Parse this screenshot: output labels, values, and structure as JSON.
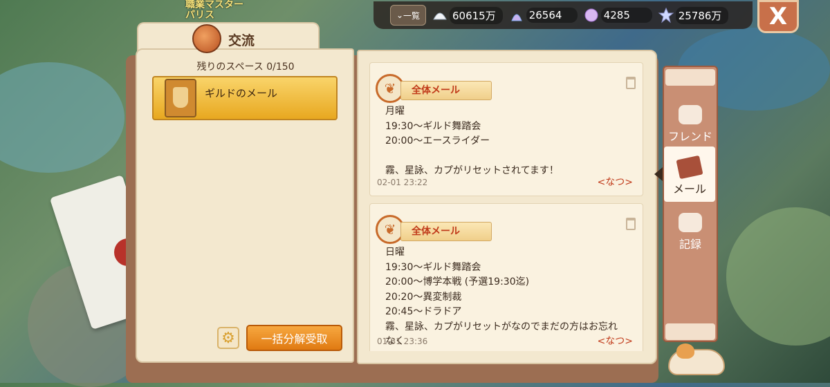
{
  "background_text": [
    "職業マスター",
    "パリス"
  ],
  "topbar": {
    "list_label": "一覧",
    "resources": [
      {
        "icon": "shell-icon",
        "value": "60615万"
      },
      {
        "icon": "seashell-star-icon",
        "value": "26564"
      },
      {
        "icon": "conch-icon",
        "value": "4285"
      },
      {
        "icon": "star-icon",
        "value": "25786万"
      }
    ],
    "close_label": "X"
  },
  "panel": {
    "title": "交流",
    "space_label": "残りのスペース 0/150",
    "guild_mail_label": "ギルドのメール",
    "bulk_button_label": "一括分解受取"
  },
  "mails": [
    {
      "type": "全体メール",
      "lines": [
        "月曜",
        "19:30～ギルド舞踏会",
        "20:00～エースライダー",
        "",
        "霧、星詠、カプがリセットされてます！"
      ],
      "date": "02-01 23:22",
      "sender": "<なつ>"
    },
    {
      "type": "全体メール",
      "lines": [
        "日曜",
        "19:30～ギルド舞踏会",
        "20:00～博学本戦 (予選19:30迄)",
        "20:20～異変制裁",
        "20:45～ドラドア",
        "霧、星詠、カプがリセットがなのでまだの方はお忘れ",
        "なく"
      ],
      "date": "01-31 23:36",
      "sender": "<なつ>"
    }
  ],
  "side_nav": {
    "tabs": [
      {
        "label": "フレンド",
        "icon": "friends-icon"
      },
      {
        "label": "メール",
        "icon": "mail-icon",
        "active": true
      },
      {
        "label": "記録",
        "icon": "gift-icon"
      }
    ]
  },
  "colors": {
    "accent_orange": "#e07a12",
    "mail_type_red": "#c03a1a",
    "page_bg": "#f3e8cf"
  }
}
